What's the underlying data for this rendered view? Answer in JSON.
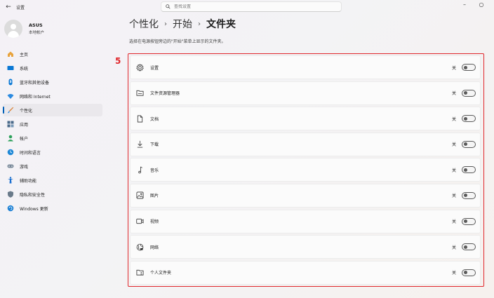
{
  "app": {
    "title": "设置",
    "search_placeholder": "查找设置"
  },
  "profile": {
    "name": "ASUS",
    "subtitle": "本地帐户"
  },
  "sidebar": {
    "items": [
      {
        "label": "主页",
        "icon": "home-icon",
        "color": "#e8a33d"
      },
      {
        "label": "系统",
        "icon": "system-icon",
        "color": "#0a78d4"
      },
      {
        "label": "蓝牙和其他设备",
        "icon": "bluetooth-icon",
        "color": "#0a78d4"
      },
      {
        "label": "网络和 Internet",
        "icon": "network-icon",
        "color": "#2b8ae0"
      },
      {
        "label": "个性化",
        "icon": "brush-icon",
        "color": "#d97b2b",
        "active": true
      },
      {
        "label": "应用",
        "icon": "apps-icon",
        "color": "#4a6a8a"
      },
      {
        "label": "帐户",
        "icon": "account-icon",
        "color": "#2ca05a"
      },
      {
        "label": "时间和语言",
        "icon": "globe-clock-icon",
        "color": "#1e88d6"
      },
      {
        "label": "游戏",
        "icon": "gamepad-icon",
        "color": "#7a8a9a"
      },
      {
        "label": "辅助功能",
        "icon": "accessibility-icon",
        "color": "#1a6fd0"
      },
      {
        "label": "隐私和安全性",
        "icon": "shield-icon",
        "color": "#6a7a8a"
      },
      {
        "label": "Windows 更新",
        "icon": "update-icon",
        "color": "#1a7fd4"
      }
    ]
  },
  "breadcrumb": {
    "level1": "个性化",
    "level2": "开始",
    "current": "文件夹"
  },
  "description": "选择在电源按钮旁边的\"开始\"菜单上显示的文件夹。",
  "annotation": {
    "number": "5",
    "color": "#e0262b"
  },
  "folders": [
    {
      "label": "设置",
      "icon": "gear-icon",
      "state": "关"
    },
    {
      "label": "文件资源管理器",
      "icon": "file-explorer-icon",
      "state": "关"
    },
    {
      "label": "文档",
      "icon": "document-icon",
      "state": "关"
    },
    {
      "label": "下载",
      "icon": "download-icon",
      "state": "关"
    },
    {
      "label": "音乐",
      "icon": "music-icon",
      "state": "关"
    },
    {
      "label": "图片",
      "icon": "picture-icon",
      "state": "关"
    },
    {
      "label": "视频",
      "icon": "video-icon",
      "state": "关"
    },
    {
      "label": "网络",
      "icon": "network-globe-icon",
      "state": "关"
    },
    {
      "label": "个人文件夹",
      "icon": "personal-folder-icon",
      "state": "关"
    }
  ]
}
